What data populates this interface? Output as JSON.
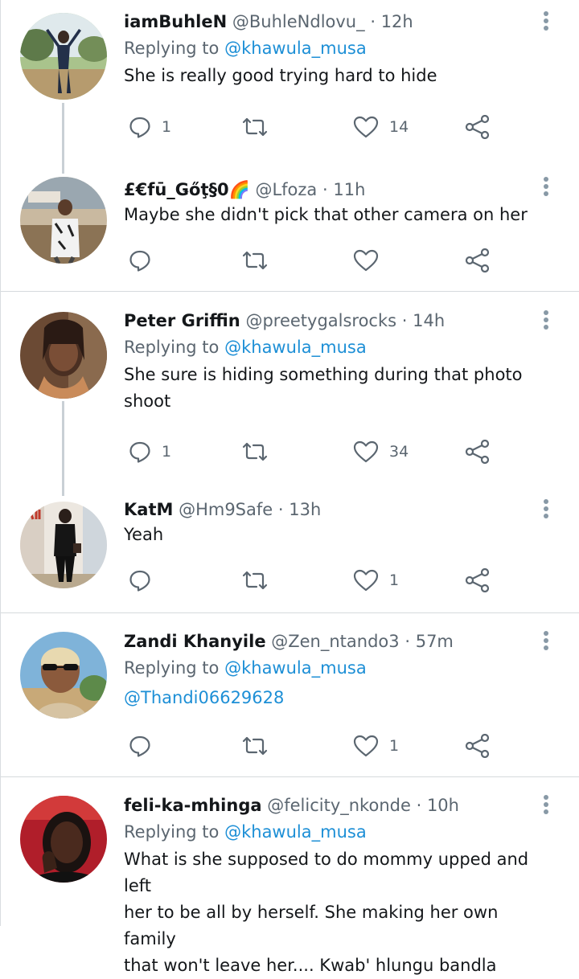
{
  "tweets": [
    {
      "name": "iamBuhleN",
      "handle": "@BuhleNdlovu_",
      "time": "12h",
      "replying_prefix": "Replying to",
      "replying_to": "@khawula_musa",
      "lines": [
        "She is really good trying hard to hide"
      ],
      "replies": "1",
      "retweets": "",
      "likes": "14"
    },
    {
      "name": "£€fū_Ǥőţ§0🌈",
      "handle": "@Lfoza",
      "time": "11h",
      "lines": [
        "Maybe she didn't pick that other camera on her"
      ],
      "replies": "",
      "retweets": "",
      "likes": ""
    },
    {
      "name": "Peter Griffin",
      "handle": "@preetygalsrocks",
      "time": "14h",
      "replying_prefix": "Replying to",
      "replying_to": "@khawula_musa",
      "lines": [
        "She sure is hiding something during that photo",
        "shoot"
      ],
      "replies": "1",
      "retweets": "",
      "likes": "34"
    },
    {
      "name": "KatM",
      "handle": "@Hm9Safe",
      "time": "13h",
      "lines": [
        "Yeah"
      ],
      "replies": "",
      "retweets": "",
      "likes": "1"
    },
    {
      "name": "Zandi Khanyile",
      "handle": "@Zen_ntando3",
      "time": "57m",
      "replying_prefix": "Replying to",
      "replying_to": "@khawula_musa",
      "lines": [
        "@Thandi06629628"
      ],
      "replies": "",
      "retweets": "",
      "likes": "1"
    },
    {
      "name": "feli-ka-mhinga",
      "handle": "@felicity_nkonde",
      "time": "10h",
      "replying_prefix": "Replying to",
      "replying_to": "@khawula_musa",
      "lines": [
        "What is she supposed to do mommy upped and left",
        "her to be all by herself. She making her own family",
        "that won't leave her.... Kwab' hlungu bandla"
      ]
    }
  ],
  "ui": {
    "dot": "·",
    "icons": {
      "reply": "reply-icon",
      "retweet": "retweet-icon",
      "like": "heart-icon",
      "share": "share-icon",
      "more": "more-vertical-icon"
    },
    "colors": {
      "text": "#14171a",
      "secondary": "#5b6670",
      "link": "#1d8fd6",
      "separator": "#d6dadd"
    }
  }
}
